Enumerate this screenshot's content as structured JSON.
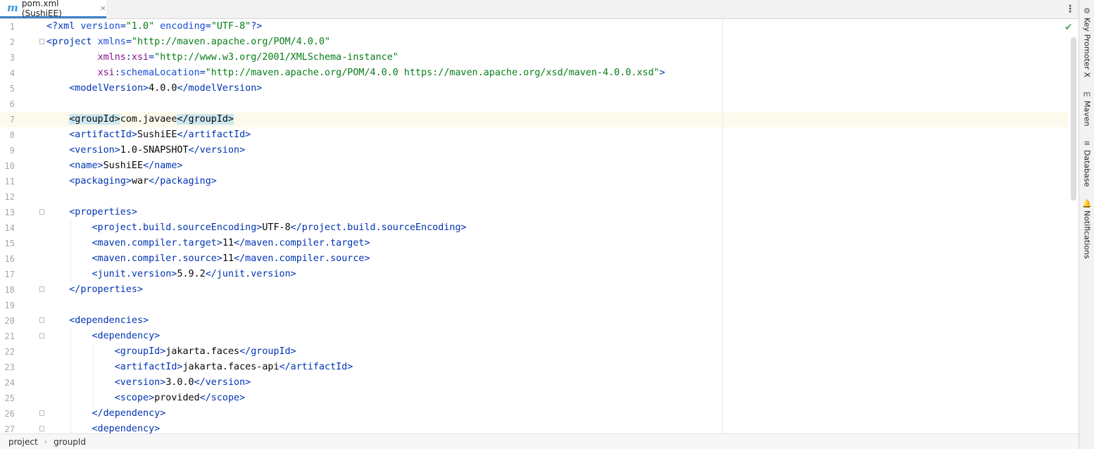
{
  "tab": {
    "icon": "maven-m-icon",
    "title": "pom.xml (SushiEE)",
    "close": "×"
  },
  "toolbar": {
    "more": "⋮"
  },
  "inspection": {
    "status": "✔"
  },
  "right_tools": [
    {
      "icon": "⚙",
      "label": "Key Promoter X"
    },
    {
      "icon": "m",
      "label": "Maven"
    },
    {
      "icon": "≡",
      "label": "Database"
    },
    {
      "icon": "🔔",
      "label": "Notifications"
    }
  ],
  "breadcrumbs": [
    "project",
    "groupId"
  ],
  "breadcrumb_sep": "›",
  "editor": {
    "current_line": 7,
    "lines": [
      {
        "n": "1",
        "segs": [
          [
            "t",
            "<?xml "
          ],
          [
            "a",
            "version"
          ],
          [
            "t",
            "="
          ],
          [
            "v",
            "\"1.0\""
          ],
          [
            "t",
            " "
          ],
          [
            "a",
            "encoding"
          ],
          [
            "t",
            "="
          ],
          [
            "v",
            "\"UTF-8\""
          ],
          [
            "t",
            "?>"
          ]
        ]
      },
      {
        "n": "2",
        "segs": [
          [
            "t",
            "<project "
          ],
          [
            "a",
            "xmlns"
          ],
          [
            "t",
            "="
          ],
          [
            "v",
            "\"http://maven.apache.org/POM/4.0.0\""
          ]
        ]
      },
      {
        "n": "3",
        "segs": [
          [
            "tx",
            "         "
          ],
          [
            "ns",
            "xmlns"
          ],
          [
            "t",
            ":"
          ],
          [
            "ns",
            "xsi"
          ],
          [
            "t",
            "="
          ],
          [
            "v",
            "\"http://www.w3.org/2001/XMLSchema-instance\""
          ]
        ]
      },
      {
        "n": "4",
        "segs": [
          [
            "tx",
            "         "
          ],
          [
            "ns",
            "xsi"
          ],
          [
            "t",
            ":"
          ],
          [
            "a",
            "schemaLocation"
          ],
          [
            "t",
            "="
          ],
          [
            "v",
            "\"http://maven.apache.org/POM/4.0.0 https://maven.apache.org/xsd/maven-4.0.0.xsd\""
          ],
          [
            "t",
            ">"
          ]
        ]
      },
      {
        "n": "5",
        "segs": [
          [
            "tx",
            "    "
          ],
          [
            "t",
            "<modelVersion>"
          ],
          [
            "tx",
            "4.0.0"
          ],
          [
            "t",
            "</modelVersion>"
          ]
        ]
      },
      {
        "n": "6",
        "segs": []
      },
      {
        "n": "7",
        "segs": [
          [
            "tx",
            "    "
          ],
          [
            "hl",
            "<groupId>"
          ],
          [
            "tx",
            "com.javaee"
          ],
          [
            "hl",
            "</groupId>"
          ]
        ]
      },
      {
        "n": "8",
        "segs": [
          [
            "tx",
            "    "
          ],
          [
            "t",
            "<artifactId>"
          ],
          [
            "tx",
            "SushiEE"
          ],
          [
            "t",
            "</artifactId>"
          ]
        ]
      },
      {
        "n": "9",
        "segs": [
          [
            "tx",
            "    "
          ],
          [
            "t",
            "<version>"
          ],
          [
            "tx",
            "1.0-SNAPSHOT"
          ],
          [
            "t",
            "</version>"
          ]
        ]
      },
      {
        "n": "10",
        "segs": [
          [
            "tx",
            "    "
          ],
          [
            "t",
            "<name>"
          ],
          [
            "tx",
            "SushiEE"
          ],
          [
            "t",
            "</name>"
          ]
        ]
      },
      {
        "n": "11",
        "segs": [
          [
            "tx",
            "    "
          ],
          [
            "t",
            "<packaging>"
          ],
          [
            "tx",
            "war"
          ],
          [
            "t",
            "</packaging>"
          ]
        ]
      },
      {
        "n": "12",
        "segs": []
      },
      {
        "n": "13",
        "segs": [
          [
            "tx",
            "    "
          ],
          [
            "t",
            "<properties>"
          ]
        ]
      },
      {
        "n": "14",
        "segs": [
          [
            "tx",
            "        "
          ],
          [
            "t",
            "<project.build.sourceEncoding>"
          ],
          [
            "tx",
            "UTF-8"
          ],
          [
            "t",
            "</project.build.sourceEncoding>"
          ]
        ]
      },
      {
        "n": "15",
        "segs": [
          [
            "tx",
            "        "
          ],
          [
            "t",
            "<maven.compiler.target>"
          ],
          [
            "tx",
            "11"
          ],
          [
            "t",
            "</maven.compiler.target>"
          ]
        ]
      },
      {
        "n": "16",
        "segs": [
          [
            "tx",
            "        "
          ],
          [
            "t",
            "<maven.compiler.source>"
          ],
          [
            "tx",
            "11"
          ],
          [
            "t",
            "</maven.compiler.source>"
          ]
        ]
      },
      {
        "n": "17",
        "segs": [
          [
            "tx",
            "        "
          ],
          [
            "t",
            "<junit.version>"
          ],
          [
            "tx",
            "5.9.2"
          ],
          [
            "t",
            "</junit.version>"
          ]
        ]
      },
      {
        "n": "18",
        "segs": [
          [
            "tx",
            "    "
          ],
          [
            "t",
            "</properties>"
          ]
        ]
      },
      {
        "n": "19",
        "segs": []
      },
      {
        "n": "20",
        "segs": [
          [
            "tx",
            "    "
          ],
          [
            "t",
            "<dependencies>"
          ]
        ]
      },
      {
        "n": "21",
        "segs": [
          [
            "tx",
            "        "
          ],
          [
            "t",
            "<dependency>"
          ]
        ]
      },
      {
        "n": "22",
        "segs": [
          [
            "tx",
            "            "
          ],
          [
            "t",
            "<groupId>"
          ],
          [
            "tx",
            "jakarta.faces"
          ],
          [
            "t",
            "</groupId>"
          ]
        ]
      },
      {
        "n": "23",
        "segs": [
          [
            "tx",
            "            "
          ],
          [
            "t",
            "<artifactId>"
          ],
          [
            "tx",
            "jakarta.faces-api"
          ],
          [
            "t",
            "</artifactId>"
          ]
        ]
      },
      {
        "n": "24",
        "segs": [
          [
            "tx",
            "            "
          ],
          [
            "t",
            "<version>"
          ],
          [
            "tx",
            "3.0.0"
          ],
          [
            "t",
            "</version>"
          ]
        ]
      },
      {
        "n": "25",
        "segs": [
          [
            "tx",
            "            "
          ],
          [
            "t",
            "<scope>"
          ],
          [
            "tx",
            "provided"
          ],
          [
            "t",
            "</scope>"
          ]
        ]
      },
      {
        "n": "26",
        "segs": [
          [
            "tx",
            "        "
          ],
          [
            "t",
            "</dependency>"
          ]
        ]
      },
      {
        "n": "27",
        "segs": [
          [
            "tx",
            "        "
          ],
          [
            "t",
            "<dependency>"
          ]
        ]
      }
    ]
  }
}
